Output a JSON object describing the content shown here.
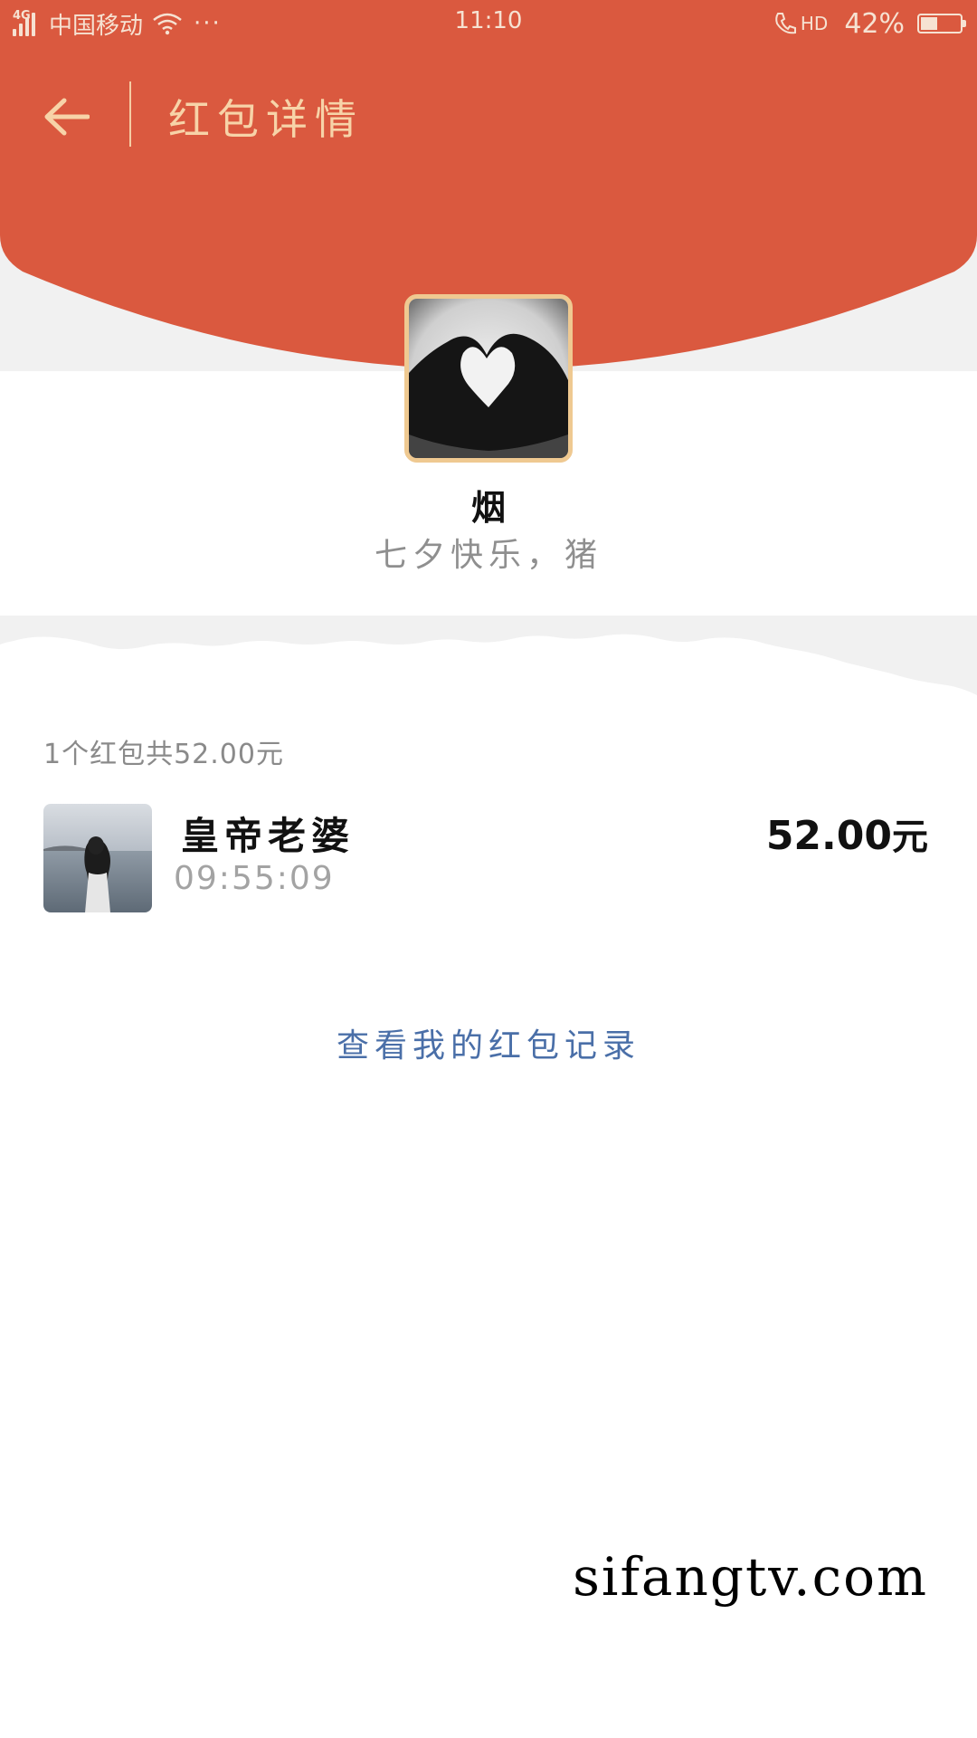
{
  "status_bar": {
    "network": "4G",
    "carrier": "中国移动",
    "more": "···",
    "time": "11:10",
    "call_tag": "HD",
    "battery": "42%",
    "battery_level": 0.42
  },
  "header": {
    "title": "红包详情",
    "back_icon": "arrow-left-icon",
    "background_color": "#da593f",
    "title_color": "#f7d3a8"
  },
  "sender": {
    "name": "烟",
    "greeting": "七夕快乐，猪"
  },
  "summary": "1个红包共52.00元",
  "records": [
    {
      "name": "皇帝老婆",
      "time": "09:55:09",
      "amount": "52.00",
      "unit": "元"
    }
  ],
  "view_records_link": "查看我的红包记录",
  "link_color": "#4a6fa8",
  "watermark": "sifangtv.com"
}
